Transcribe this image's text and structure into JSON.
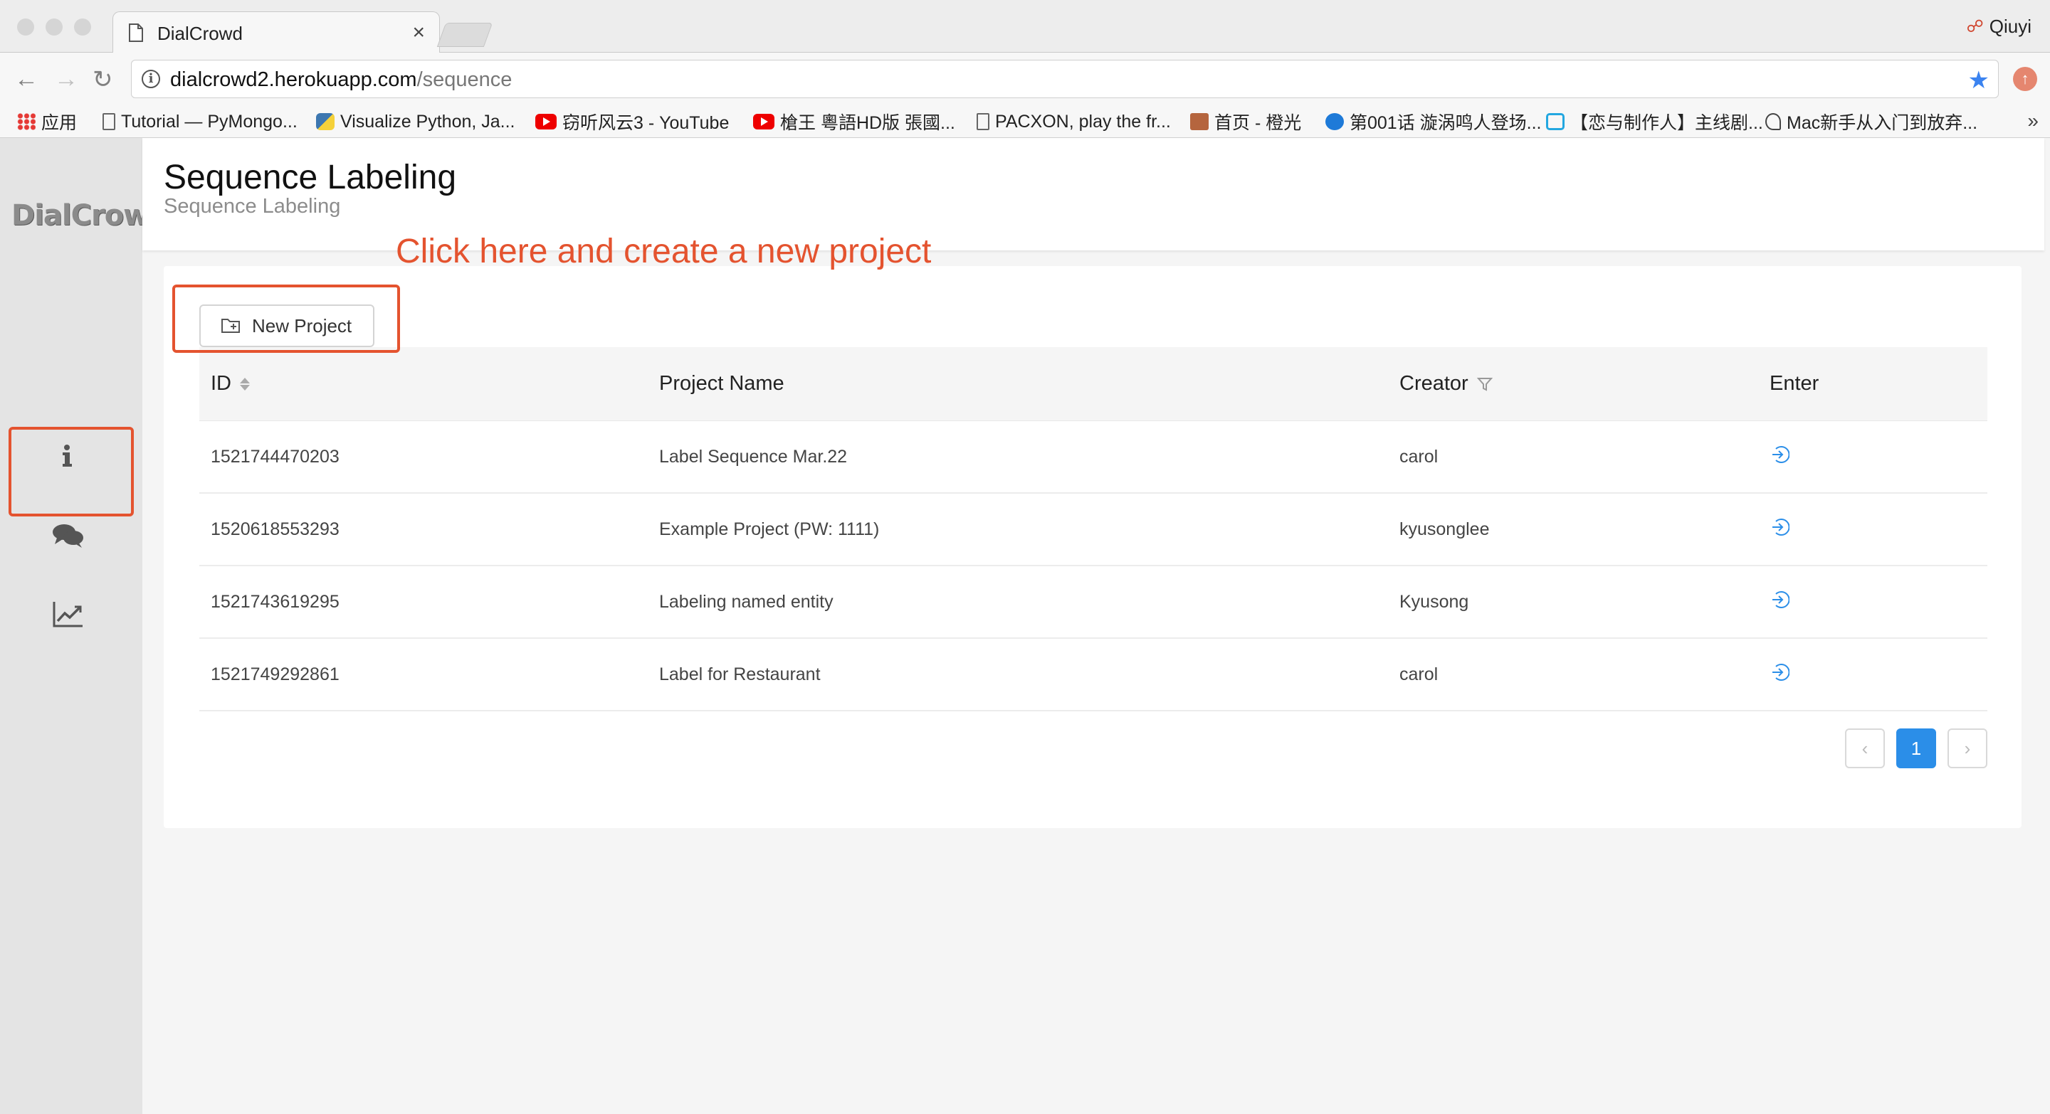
{
  "browser": {
    "tab_title": "DialCrowd",
    "profile_name": "Qiuyi",
    "url_host": "dialcrowd2.herokuapp.com",
    "url_path": "/sequence",
    "bookmarks": [
      {
        "icon": "apps-grid-icon",
        "label": "应用"
      },
      {
        "icon": "document-icon",
        "label": "Tutorial — PyMongo..."
      },
      {
        "icon": "python-icon",
        "label": "Visualize Python, Ja..."
      },
      {
        "icon": "youtube-icon",
        "label": "窃听风云3 - YouTube"
      },
      {
        "icon": "youtube-icon",
        "label": "槍王 粵語HD版 張國..."
      },
      {
        "icon": "document-icon",
        "label": "PACXON, play the fr..."
      },
      {
        "icon": "avatar-icon",
        "label": "首页 - 橙光"
      },
      {
        "icon": "play-circle-icon",
        "label": "第001话 漩涡鸣人登场..."
      },
      {
        "icon": "bilibili-icon",
        "label": "【恋与制作人】主线剧..."
      },
      {
        "icon": "sketch-icon",
        "label": "Mac新手从入门到放弃..."
      }
    ],
    "more_bookmarks": "»"
  },
  "sidebar": {
    "logo": "DialCrowd",
    "items": [
      {
        "icon": "info-icon"
      },
      {
        "icon": "chat-icon"
      },
      {
        "icon": "line-chart-icon"
      }
    ]
  },
  "header": {
    "title": "Sequence Labeling",
    "subtitle": "Sequence Labeling"
  },
  "annotation": "Click here and create a new project",
  "new_project_label": "New Project",
  "table": {
    "columns": [
      "ID",
      "Project Name",
      "Creator",
      "Enter"
    ],
    "rows": [
      {
        "id": "1521744470203",
        "name": "Label Sequence Mar.22",
        "creator": "carol"
      },
      {
        "id": "1520618553293",
        "name": "Example Project (PW: 1111)",
        "creator": "kyusonglee"
      },
      {
        "id": "1521743619295",
        "name": "Labeling named entity",
        "creator": "Kyusong"
      },
      {
        "id": "1521749292861",
        "name": "Label for Restaurant",
        "creator": "carol"
      }
    ]
  },
  "pagination": {
    "prev": "‹",
    "current": "1",
    "next": "›"
  },
  "colors": {
    "accent": "#2b8ee8",
    "annotation": "#e4532f"
  }
}
